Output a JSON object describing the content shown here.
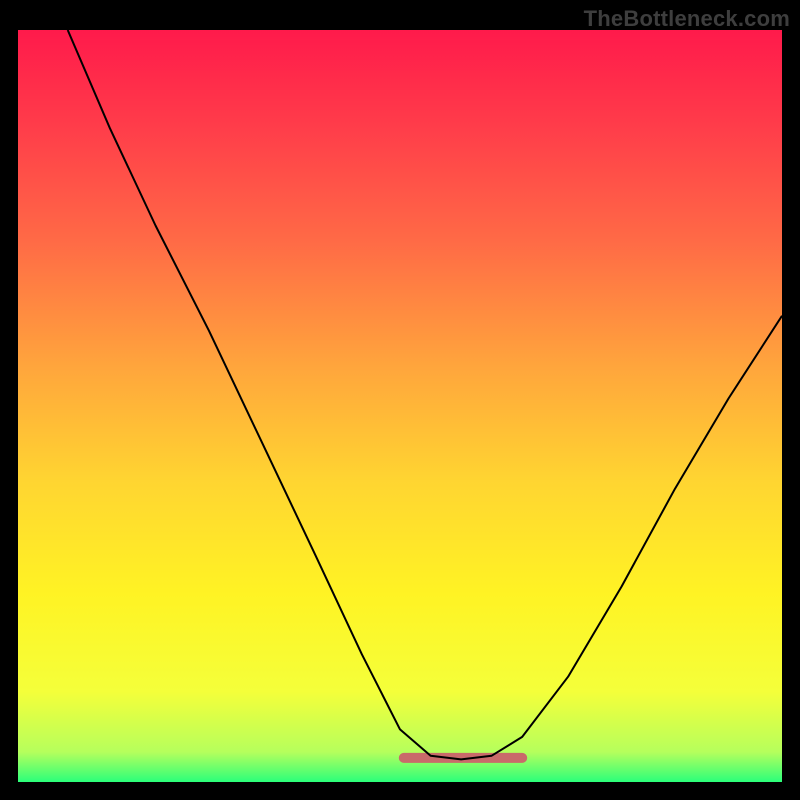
{
  "watermark": "TheBottleneck.com",
  "gradient": {
    "stops": [
      {
        "offset": "0%",
        "color": "#ff1a4b"
      },
      {
        "offset": "12%",
        "color": "#ff3a4a"
      },
      {
        "offset": "28%",
        "color": "#ff6a46"
      },
      {
        "offset": "45%",
        "color": "#ffa63c"
      },
      {
        "offset": "60%",
        "color": "#ffd531"
      },
      {
        "offset": "75%",
        "color": "#fff324"
      },
      {
        "offset": "88%",
        "color": "#f4ff3a"
      },
      {
        "offset": "96%",
        "color": "#b6ff5c"
      },
      {
        "offset": "100%",
        "color": "#2bff7a"
      }
    ]
  },
  "baseSegment": {
    "color": "#c96a6a",
    "y": 0.968,
    "x0": 0.505,
    "x1": 0.66
  },
  "chart_data": {
    "type": "line",
    "title": "",
    "xlabel": "",
    "ylabel": "",
    "xlim": [
      0,
      1
    ],
    "ylim": [
      0,
      1
    ],
    "note": "Axes unlabeled; x,y normalized to plot area (y=1 at top, y=0 at bottom).",
    "series": [
      {
        "name": "curve",
        "points": [
          {
            "x": 0.065,
            "y": 1.0
          },
          {
            "x": 0.12,
            "y": 0.87
          },
          {
            "x": 0.18,
            "y": 0.74
          },
          {
            "x": 0.25,
            "y": 0.6
          },
          {
            "x": 0.32,
            "y": 0.45
          },
          {
            "x": 0.39,
            "y": 0.3
          },
          {
            "x": 0.45,
            "y": 0.17
          },
          {
            "x": 0.5,
            "y": 0.07
          },
          {
            "x": 0.54,
            "y": 0.035
          },
          {
            "x": 0.58,
            "y": 0.03
          },
          {
            "x": 0.62,
            "y": 0.035
          },
          {
            "x": 0.66,
            "y": 0.06
          },
          {
            "x": 0.72,
            "y": 0.14
          },
          {
            "x": 0.79,
            "y": 0.26
          },
          {
            "x": 0.86,
            "y": 0.39
          },
          {
            "x": 0.93,
            "y": 0.51
          },
          {
            "x": 1.0,
            "y": 0.62
          }
        ]
      }
    ]
  }
}
